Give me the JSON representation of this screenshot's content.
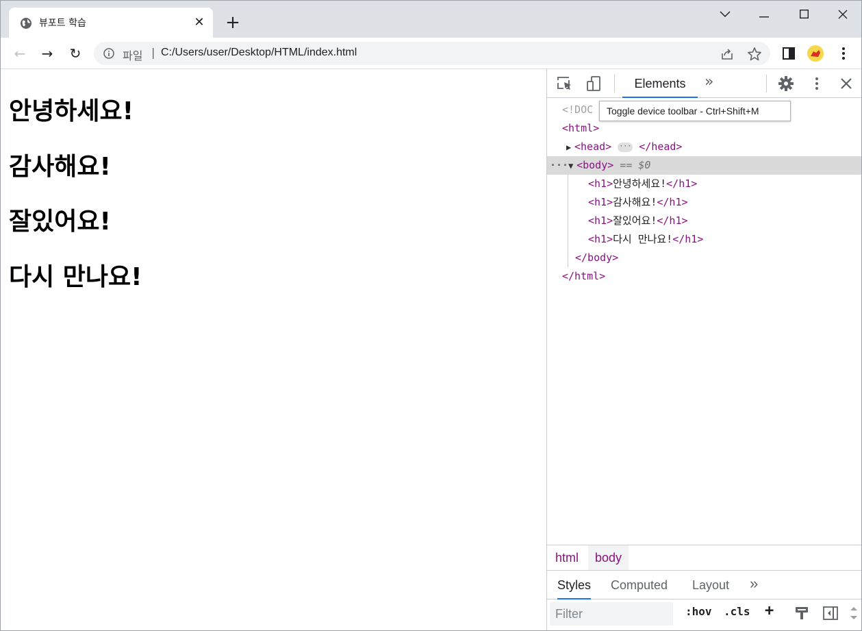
{
  "browser": {
    "tab_title": "뷰포트 학습",
    "tab_close": "✕",
    "new_tab": "+",
    "window_controls": {
      "collapse": "⌄",
      "minimize": "—",
      "maximize": "☐",
      "close": "✕"
    }
  },
  "toolbar": {
    "back": "←",
    "forward": "→",
    "reload": "↻",
    "scheme_label": "파일",
    "separator": "|",
    "url": "C:/Users/user/Desktop/HTML/index.html"
  },
  "page": {
    "headings": [
      "안녕하세요!",
      "감사해요!",
      "잘있어요!",
      "다시 만나요!"
    ]
  },
  "devtools": {
    "tab_elements": "Elements",
    "more_tabs": "»",
    "tooltip": "Toggle device toolbar - Ctrl+Shift+M",
    "tree": {
      "doctype": "<!DOC",
      "html_open": "<html>",
      "head_open": "<head>",
      "head_close": "</head>",
      "body_open": "<body>",
      "body_eq": " == $0",
      "h1_open": "<h1>",
      "h1_close": "</h1>",
      "h1_texts": [
        "안녕하세요!",
        "감사해요!",
        "잘있어요!",
        "다시 만나요!"
      ],
      "body_close": "</body>",
      "html_close": "</html>",
      "row_dots": "···",
      "pill_dots": "···"
    },
    "breadcrumbs": [
      "html",
      "body"
    ],
    "subtabs": [
      "Styles",
      "Computed",
      "Layout"
    ],
    "subtabs_more": "»",
    "filter_placeholder": "Filter",
    "hov": ":hov",
    "cls": ".cls",
    "add": "+"
  },
  "colors": {
    "tag": "#881280",
    "accent": "#1a73e8",
    "tabstrip": "#dee1e6"
  }
}
